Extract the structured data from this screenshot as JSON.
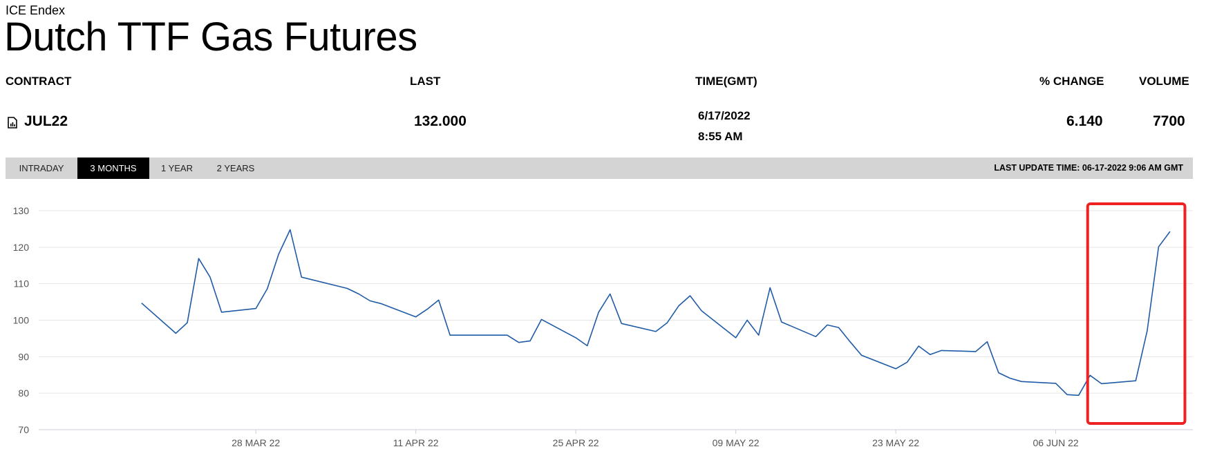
{
  "header": {
    "exchange": "ICE Endex",
    "title": "Dutch TTF Gas Futures"
  },
  "table": {
    "headers": {
      "contract": "CONTRACT",
      "last": "LAST",
      "time": "TIME(GMT)",
      "change": "% CHANGE",
      "volume": "VOLUME"
    },
    "row": {
      "contract_icon": "chart-document-icon",
      "contract": "JUL22",
      "last": "132.000",
      "date": "6/17/2022",
      "time": "8:55 AM",
      "change": "6.140",
      "volume": "7700"
    }
  },
  "tabs": [
    {
      "label": "INTRADAY",
      "active": false
    },
    {
      "label": "3 MONTHS",
      "active": true
    },
    {
      "label": "1 YEAR",
      "active": false
    },
    {
      "label": "2 YEARS",
      "active": false
    }
  ],
  "last_update": "LAST UPDATE TIME: 06-17-2022 9:06 AM GMT",
  "colors": {
    "line": "#1f5aa6",
    "highlight": "#ee2222",
    "tabbar": "#d4d4d4"
  },
  "chart_data": {
    "type": "line",
    "title": "",
    "xlabel": "",
    "ylabel": "",
    "ylim": [
      70,
      130
    ],
    "yticks": [
      70,
      80,
      90,
      100,
      110,
      120,
      130
    ],
    "xticks": [
      "2022-03-28",
      "2022-04-11",
      "2022-04-25",
      "2022-05-09",
      "2022-05-23",
      "2022-06-06"
    ],
    "xtick_labels": [
      "28 MAR 22",
      "11 APR 22",
      "25 APR 22",
      "09 MAY 22",
      "23 MAY 22",
      "06 JUN 22"
    ],
    "grid": true,
    "legend": "none",
    "highlight_range": [
      "2022-06-10",
      "2022-06-17"
    ],
    "series": [
      {
        "x": [
          "2022-03-18",
          "2022-03-21",
          "2022-03-22",
          "2022-03-23",
          "2022-03-24",
          "2022-03-25",
          "2022-03-28",
          "2022-03-29",
          "2022-03-30",
          "2022-03-31",
          "2022-04-01",
          "2022-04-05",
          "2022-04-06",
          "2022-04-07",
          "2022-04-08",
          "2022-04-11",
          "2022-04-12",
          "2022-04-13",
          "2022-04-14",
          "2022-04-19",
          "2022-04-20",
          "2022-04-21",
          "2022-04-22",
          "2022-04-25",
          "2022-04-26",
          "2022-04-27",
          "2022-04-28",
          "2022-04-29",
          "2022-05-02",
          "2022-05-03",
          "2022-05-04",
          "2022-05-05",
          "2022-05-06",
          "2022-05-09",
          "2022-05-10",
          "2022-05-11",
          "2022-05-12",
          "2022-05-13",
          "2022-05-16",
          "2022-05-17",
          "2022-05-18",
          "2022-05-19",
          "2022-05-20",
          "2022-05-23",
          "2022-05-24",
          "2022-05-25",
          "2022-05-26",
          "2022-05-27",
          "2022-05-30",
          "2022-05-31",
          "2022-06-01",
          "2022-06-02",
          "2022-06-03",
          "2022-06-06",
          "2022-06-07",
          "2022-06-08",
          "2022-06-09",
          "2022-06-10",
          "2022-06-13",
          "2022-06-14",
          "2022-06-15",
          "2022-06-16"
        ],
        "values": [
          104.7,
          96.4,
          99.3,
          116.9,
          111.8,
          102.2,
          103.2,
          108.6,
          118.1,
          124.8,
          111.8,
          108.7,
          107.2,
          105.3,
          104.5,
          100.9,
          103.0,
          105.5,
          95.9,
          95.9,
          93.9,
          94.3,
          100.2,
          95.2,
          93.0,
          102.2,
          107.2,
          99.1,
          96.9,
          99.3,
          103.9,
          106.7,
          102.6,
          95.2,
          100.0,
          95.9,
          108.9,
          99.5,
          95.5,
          98.7,
          98.0,
          94.1,
          90.4,
          86.7,
          88.5,
          92.9,
          90.6,
          91.7,
          91.4,
          94.1,
          85.6,
          84.1,
          83.2,
          82.7,
          79.6,
          79.4,
          84.9,
          82.6,
          83.4,
          97.1,
          120.1,
          124.3
        ]
      }
    ]
  }
}
